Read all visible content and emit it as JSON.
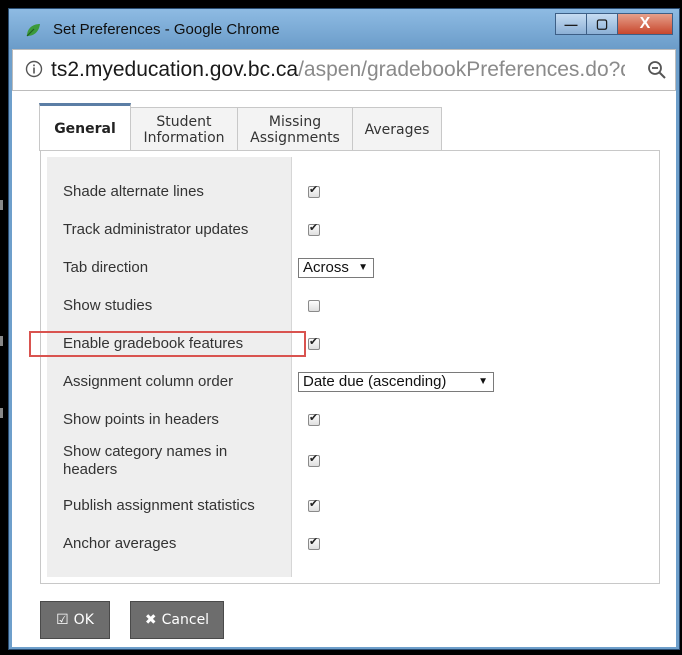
{
  "window": {
    "title": "Set Preferences - Google Chrome",
    "minimize_glyph": "—",
    "maximize_glyph": "▢",
    "close_glyph": "X"
  },
  "address_bar": {
    "host": "ts2.myeducation.gov.bc.ca",
    "path": "/aspen/gradebookPreferences.do?de"
  },
  "tabs": [
    {
      "label": "General",
      "active": true
    },
    {
      "label": "Student\nInformation",
      "active": false
    },
    {
      "label": "Missing\nAssignments",
      "active": false
    },
    {
      "label": "Averages",
      "active": false
    }
  ],
  "preferences": [
    {
      "label": "Shade alternate lines",
      "control": "checkbox",
      "checked": true
    },
    {
      "label": "Track administrator updates",
      "control": "checkbox",
      "checked": true
    },
    {
      "label": "Tab direction",
      "control": "select",
      "value": "Across"
    },
    {
      "label": "Show studies",
      "control": "checkbox",
      "checked": false
    },
    {
      "label": "Enable gradebook features",
      "control": "checkbox",
      "checked": true,
      "highlighted": true
    },
    {
      "label": "Assignment column order",
      "control": "select",
      "value": "Date due (ascending)"
    },
    {
      "label": "Show points in headers",
      "control": "checkbox",
      "checked": true
    },
    {
      "label": "Show category names in headers",
      "control": "checkbox",
      "checked": true
    },
    {
      "label": "Publish assignment statistics",
      "control": "checkbox",
      "checked": true
    },
    {
      "label": "Anchor averages",
      "control": "checkbox",
      "checked": true
    }
  ],
  "buttons": {
    "ok_label": "OK",
    "cancel_label": "Cancel"
  },
  "colors": {
    "window_frame": "#6e9fcb",
    "highlight_box": "#d9534f",
    "button_bg": "#6d6d6d",
    "active_tab_accent": "#5b7ea5"
  }
}
